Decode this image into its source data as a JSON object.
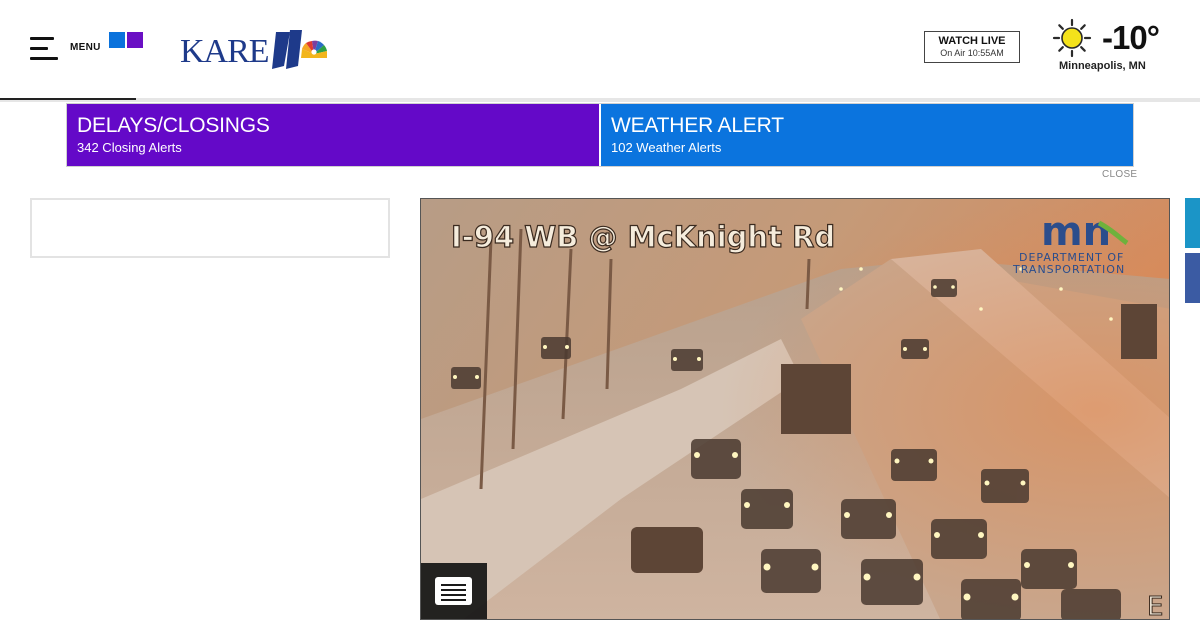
{
  "header": {
    "menu_label": "MENU",
    "logo_text": "KARE",
    "logo_number": "11",
    "watch_live": {
      "title": "WATCH LIVE",
      "subtitle": "On Air 10:55AM"
    },
    "weather": {
      "temperature": "-10°",
      "location": "Minneapolis, MN",
      "icon": "sun-icon"
    }
  },
  "alerts": {
    "delays": {
      "title": "DELAYS/CLOSINGS",
      "subtitle": "342 Closing Alerts"
    },
    "weather": {
      "title": "WEATHER ALERT",
      "subtitle": "102 Weather Alerts"
    },
    "close_label": "CLOSE"
  },
  "camera": {
    "overlay_text": "I-94 WB @ McKnight Rd",
    "brand_short": "mn",
    "brand_line1": "DEPARTMENT OF",
    "brand_line2": "TRANSPORTATION",
    "corner_letter": "E",
    "captions_icon": "closed-captions-icon"
  },
  "social": {
    "twitter_icon": "twitter-icon",
    "facebook_icon": "facebook-icon"
  },
  "colors": {
    "delays": "#6409c8",
    "weather_alert": "#0b74de",
    "brand_navy": "#1e3a8a",
    "twitter": "#1b95c7",
    "facebook": "#3b5ba3"
  }
}
